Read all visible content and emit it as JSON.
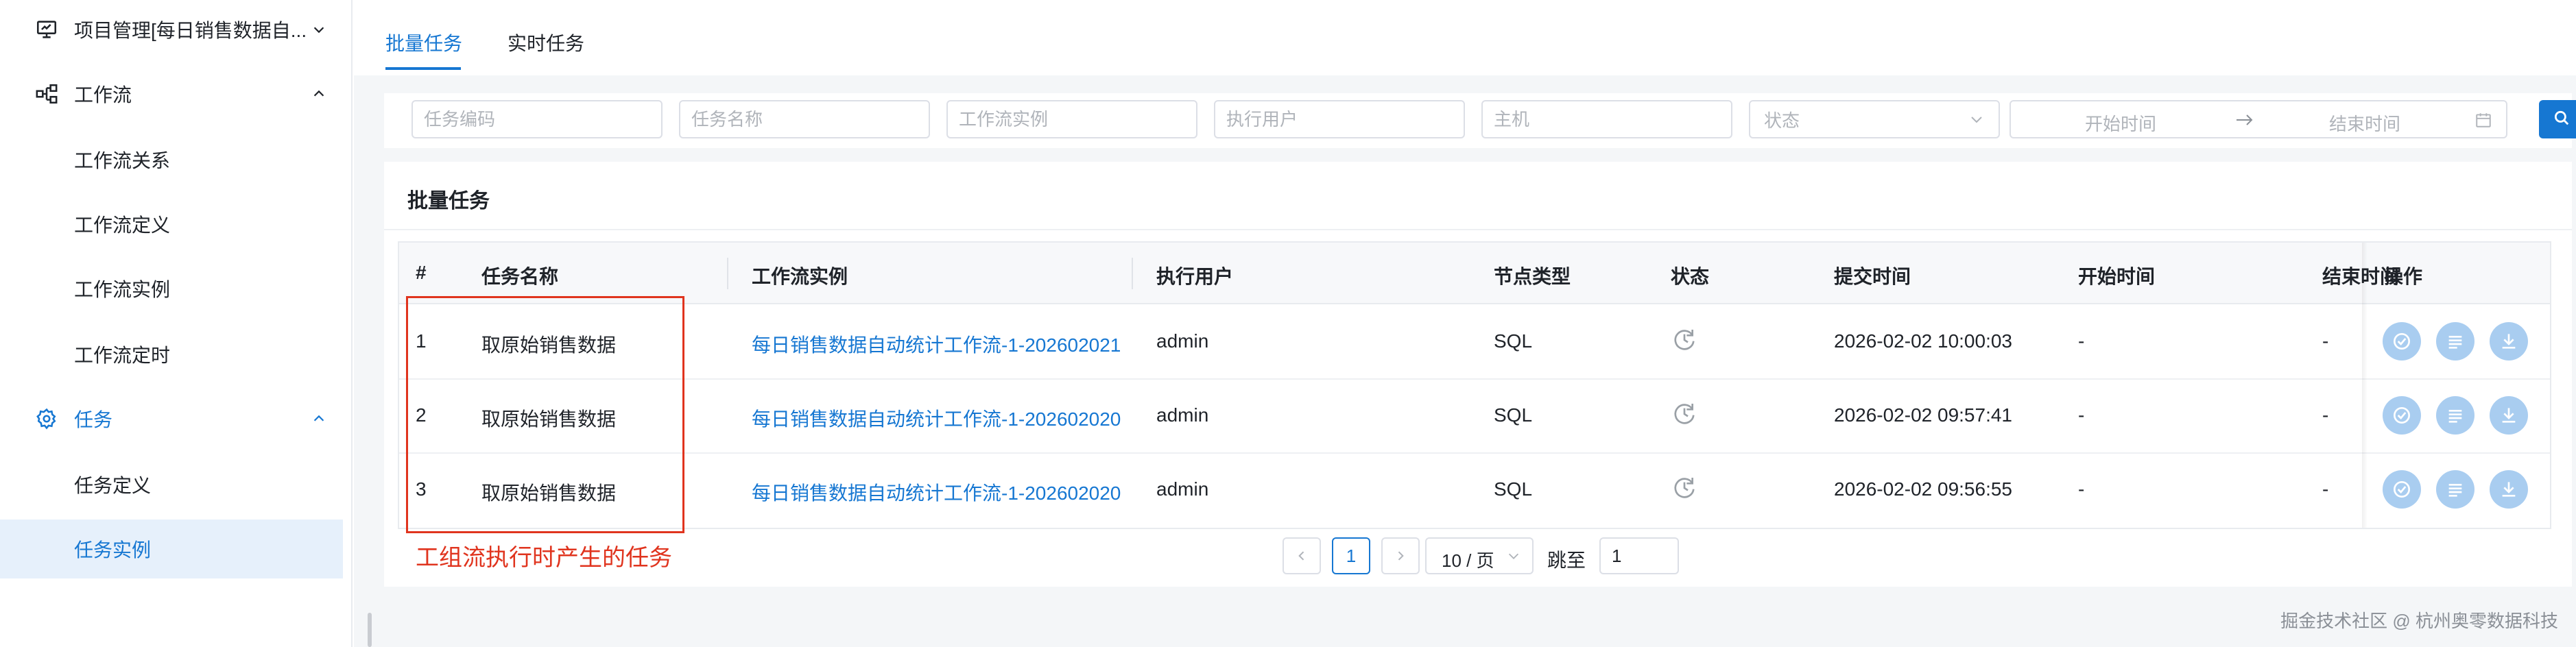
{
  "sidebar": {
    "items": [
      {
        "label": "项目管理[每日销售数据自...",
        "icon": "project-monitor-icon",
        "chevron": "down"
      },
      {
        "label": "工作流",
        "icon": "workflow-icon",
        "chevron": "up"
      },
      {
        "label": "工作流关系"
      },
      {
        "label": "工作流定义"
      },
      {
        "label": "工作流实例"
      },
      {
        "label": "工作流定时"
      },
      {
        "label": "任务",
        "icon": "gear-icon",
        "chevron": "up"
      },
      {
        "label": "任务定义"
      },
      {
        "label": "任务实例"
      }
    ]
  },
  "tabs": [
    {
      "label": "批量任务",
      "active": true
    },
    {
      "label": "实时任务",
      "active": false
    }
  ],
  "filters": {
    "task_code_placeholder": "任务编码",
    "task_name_placeholder": "任务名称",
    "workflow_instance_placeholder": "工作流实例",
    "executor_placeholder": "执行用户",
    "host_placeholder": "主机",
    "status_placeholder": "状态",
    "start_time_placeholder": "开始时间",
    "end_time_placeholder": "结束时间"
  },
  "panel": {
    "title": "批量任务"
  },
  "table": {
    "headers": [
      "#",
      "任务名称",
      "工作流实例",
      "执行用户",
      "节点类型",
      "状态",
      "提交时间",
      "开始时间",
      "结束时间",
      "操作"
    ],
    "rows": [
      {
        "index": "1",
        "task_name": "取原始销售数据",
        "workflow_instance": "每日销售数据自动统计工作流-1-202602021",
        "user": "admin",
        "node_type": "SQL",
        "status_icon": "clock-pending-icon",
        "submit_time": "2026-02-02 10:00:03",
        "start_time": "-",
        "end_time": "-"
      },
      {
        "index": "2",
        "task_name": "取原始销售数据",
        "workflow_instance": "每日销售数据自动统计工作流-1-202602020",
        "user": "admin",
        "node_type": "SQL",
        "status_icon": "clock-pending-icon",
        "submit_time": "2026-02-02 09:57:41",
        "start_time": "-",
        "end_time": "-"
      },
      {
        "index": "3",
        "task_name": "取原始销售数据",
        "workflow_instance": "每日销售数据自动统计工作流-1-202602020",
        "user": "admin",
        "node_type": "SQL",
        "status_icon": "clock-pending-icon",
        "submit_time": "2026-02-02 09:56:55",
        "start_time": "-",
        "end_time": "-"
      }
    ],
    "row_actions": [
      "check-circle-icon",
      "list-log-icon",
      "download-icon"
    ]
  },
  "pagination": {
    "current_page": "1",
    "page_size": "10 / 页",
    "jump_label": "跳至",
    "jump_value": "1"
  },
  "annotation": {
    "text": "工组流执行时产生的任务"
  },
  "watermark": "掘金技术社区 @ 杭州奥零数据科技",
  "colors": {
    "accent": "#1677d2",
    "annotation": "#e0341e",
    "action_button": "#a9cdf0"
  }
}
